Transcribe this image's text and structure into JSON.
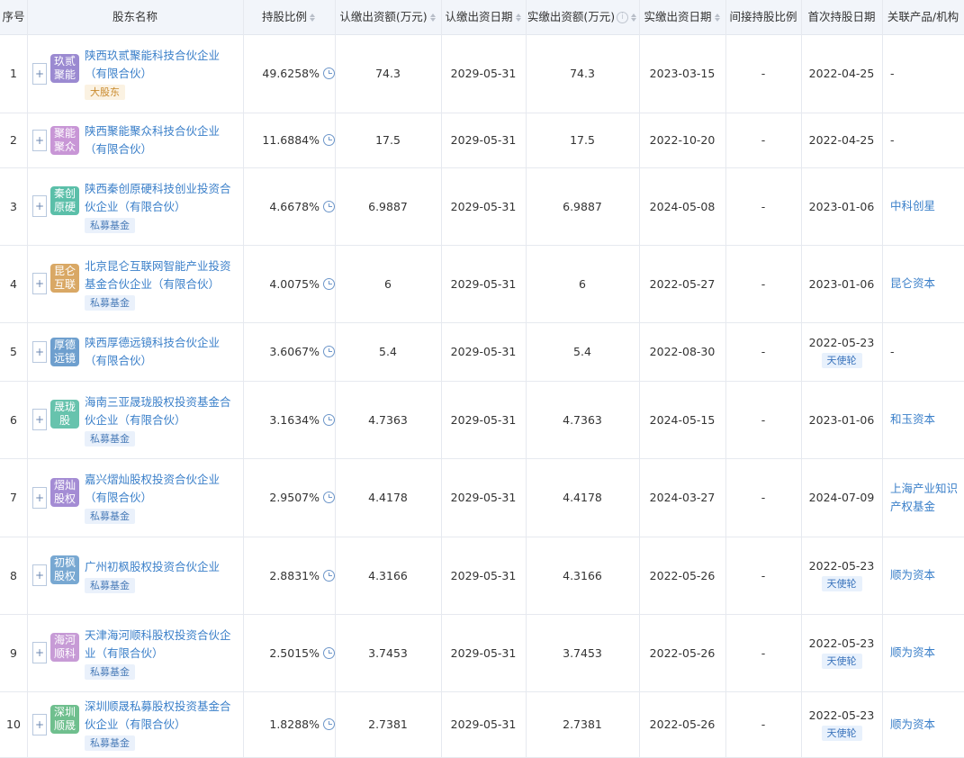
{
  "header": {
    "index": "序号",
    "name": "股东名称",
    "ratio": "持股比例",
    "subscribed_amount": "认缴出资额(万元)",
    "subscribed_date": "认缴出资日期",
    "paid_amount": "实缴出资额(万元)",
    "paid_date": "实缴出资日期",
    "indirect_ratio": "间接持股比例",
    "first_date": "首次持股日期",
    "related": "关联产品/机构"
  },
  "colors": {
    "link": "#3a7fc9",
    "header_bg": "#f2f5fa",
    "border": "#e6e9ef"
  },
  "rows": [
    {
      "index": "1",
      "logo_text": "玖贰聚能",
      "logo_color": "#9b8ad1",
      "name": "陕西玖贰聚能科技合伙企业（有限合伙）",
      "badge": "大股东",
      "ratio": "49.6258%",
      "subscribed_amount": "74.3",
      "subscribed_date": "2029-05-31",
      "paid_amount": "74.3",
      "paid_date": "2023-03-15",
      "indirect_ratio": "-",
      "first_date": "2022-04-25",
      "round": "",
      "related": "-"
    },
    {
      "index": "2",
      "logo_text": "聚能聚众",
      "logo_color": "#c896d6",
      "name": "陕西聚能聚众科技合伙企业（有限合伙）",
      "badge": "",
      "ratio": "11.6884%",
      "subscribed_amount": "17.5",
      "subscribed_date": "2029-05-31",
      "paid_amount": "17.5",
      "paid_date": "2022-10-20",
      "indirect_ratio": "-",
      "first_date": "2022-04-25",
      "round": "",
      "related": "-"
    },
    {
      "index": "3",
      "logo_text": "秦创原硬",
      "logo_color": "#5bbfa9",
      "name": "陕西秦创原硬科技创业投资合伙企业（有限合伙）",
      "badge": "私募基金",
      "ratio": "4.6678%",
      "subscribed_amount": "6.9887",
      "subscribed_date": "2029-05-31",
      "paid_amount": "6.9887",
      "paid_date": "2024-05-08",
      "indirect_ratio": "-",
      "first_date": "2023-01-06",
      "round": "",
      "related": "中科创星"
    },
    {
      "index": "4",
      "logo_text": "昆仑互联",
      "logo_color": "#d9a865",
      "name": "北京昆仑互联网智能产业投资基金合伙企业（有限合伙）",
      "badge": "私募基金",
      "ratio": "4.0075%",
      "subscribed_amount": "6",
      "subscribed_date": "2029-05-31",
      "paid_amount": "6",
      "paid_date": "2022-05-27",
      "indirect_ratio": "-",
      "first_date": "2023-01-06",
      "round": "",
      "related": "昆仑资本"
    },
    {
      "index": "5",
      "logo_text": "厚德远镜",
      "logo_color": "#6e9fce",
      "name": "陕西厚德远镜科技合伙企业（有限合伙）",
      "badge": "",
      "ratio": "3.6067%",
      "subscribed_amount": "5.4",
      "subscribed_date": "2029-05-31",
      "paid_amount": "5.4",
      "paid_date": "2022-08-30",
      "indirect_ratio": "-",
      "first_date": "2022-05-23",
      "round": "天使轮",
      "related": "-"
    },
    {
      "index": "6",
      "logo_text": "晟珑股",
      "logo_color": "#67c3ad",
      "name": "海南三亚晟珑股权投资基金合伙企业（有限合伙）",
      "badge": "私募基金",
      "ratio": "3.1634%",
      "subscribed_amount": "4.7363",
      "subscribed_date": "2029-05-31",
      "paid_amount": "4.7363",
      "paid_date": "2024-05-15",
      "indirect_ratio": "-",
      "first_date": "2023-01-06",
      "round": "",
      "related": "和玉资本"
    },
    {
      "index": "7",
      "logo_text": "熠灿股权",
      "logo_color": "#a48cd4",
      "name": "嘉兴熠灿股权投资合伙企业（有限合伙）",
      "badge": "私募基金",
      "ratio": "2.9507%",
      "subscribed_amount": "4.4178",
      "subscribed_date": "2029-05-31",
      "paid_amount": "4.4178",
      "paid_date": "2024-03-27",
      "indirect_ratio": "-",
      "first_date": "2024-07-09",
      "round": "",
      "related": "上海产业知识产权基金"
    },
    {
      "index": "8",
      "logo_text": "初枫股权",
      "logo_color": "#78a8d2",
      "name": "广州初枫股权投资合伙企业",
      "badge": "私募基金",
      "ratio": "2.8831%",
      "subscribed_amount": "4.3166",
      "subscribed_date": "2029-05-31",
      "paid_amount": "4.3166",
      "paid_date": "2022-05-26",
      "indirect_ratio": "-",
      "first_date": "2022-05-23",
      "round": "天使轮",
      "related": "顺为资本"
    },
    {
      "index": "9",
      "logo_text": "海河顺科",
      "logo_color": "#c79bd6",
      "name": "天津海河顺科股权投资合伙企业（有限合伙）",
      "badge": "私募基金",
      "ratio": "2.5015%",
      "subscribed_amount": "3.7453",
      "subscribed_date": "2029-05-31",
      "paid_amount": "3.7453",
      "paid_date": "2022-05-26",
      "indirect_ratio": "-",
      "first_date": "2022-05-23",
      "round": "天使轮",
      "related": "顺为资本"
    },
    {
      "index": "10",
      "logo_text": "深圳顺晟",
      "logo_color": "#6fbf8e",
      "name": "深圳顺晟私募股权投资基金合伙企业（有限合伙）",
      "badge": "私募基金",
      "ratio": "1.8288%",
      "subscribed_amount": "2.7381",
      "subscribed_date": "2029-05-31",
      "paid_amount": "2.7381",
      "paid_date": "2022-05-26",
      "indirect_ratio": "-",
      "first_date": "2022-05-23",
      "round": "天使轮",
      "related": "顺为资本"
    }
  ]
}
